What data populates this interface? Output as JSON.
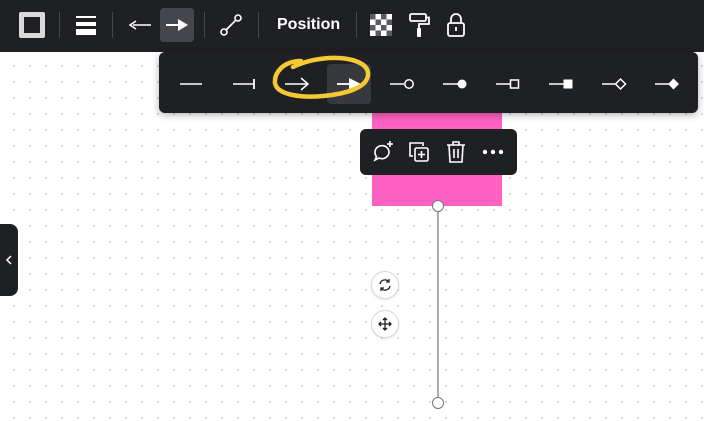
{
  "toolbar": {
    "items": [
      {
        "name": "color-picker-icon"
      },
      {
        "name": "line-weight-icon"
      },
      {
        "name": "line-start-icon"
      },
      {
        "name": "line-end-icon"
      },
      {
        "name": "line-style-icon"
      }
    ],
    "position_label": "Position",
    "right_icons": [
      "transparency-icon",
      "paint-roller-icon",
      "lock-icon"
    ]
  },
  "line_end_options": {
    "items": [
      {
        "name": "none",
        "icon": "line-plain-icon"
      },
      {
        "name": "bar",
        "icon": "line-bar-end-icon"
      },
      {
        "name": "arrow",
        "icon": "line-arrow-icon"
      },
      {
        "name": "triangle",
        "icon": "line-triangle-arrow-icon"
      },
      {
        "name": "circle",
        "icon": "line-circle-outline-icon"
      },
      {
        "name": "circle-filled",
        "icon": "line-circle-filled-icon"
      },
      {
        "name": "square",
        "icon": "line-square-outline-icon"
      },
      {
        "name": "square-filled",
        "icon": "line-square-filled-icon"
      },
      {
        "name": "diamond",
        "icon": "line-diamond-outline-icon"
      },
      {
        "name": "diamond-filled",
        "icon": "line-diamond-filled-icon"
      }
    ],
    "selected": "triangle"
  },
  "context_menu": {
    "icons": [
      "add-comment-icon",
      "duplicate-icon",
      "delete-icon",
      "more-icon"
    ]
  },
  "colors": {
    "toolbar_bg": "#1f2023",
    "sticky_note": "#ff61c3",
    "highlight_circle": "#f5c932",
    "connector": "#a7b0b8"
  }
}
